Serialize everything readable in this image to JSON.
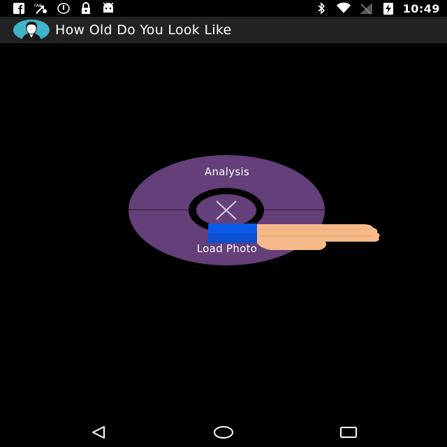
{
  "status_bar": {
    "time": "10:49",
    "left_icons": [
      "facebook-icon",
      "fake-gps-icon",
      "sync-icon",
      "lock-icon",
      "android-icon"
    ],
    "right_icons": [
      "bluetooth-icon",
      "wifi-icon",
      "no-signal-icon",
      "battery-charging-icon"
    ]
  },
  "app_bar": {
    "title": "How Old Do You Look Like",
    "logo_icon": "face-avatar-icon",
    "accent_color": "#3fb4c8"
  },
  "radial_menu": {
    "top_label": "Analysis",
    "bottom_label": "Load Photo",
    "center_icon": "close-icon",
    "color": "#643f79"
  },
  "pointer_overlay": {
    "icon": "hand-pointer-icon",
    "cuff_color": "#0a5be8"
  },
  "nav_bar": {
    "buttons": [
      "back-icon",
      "home-icon",
      "recents-icon"
    ]
  }
}
